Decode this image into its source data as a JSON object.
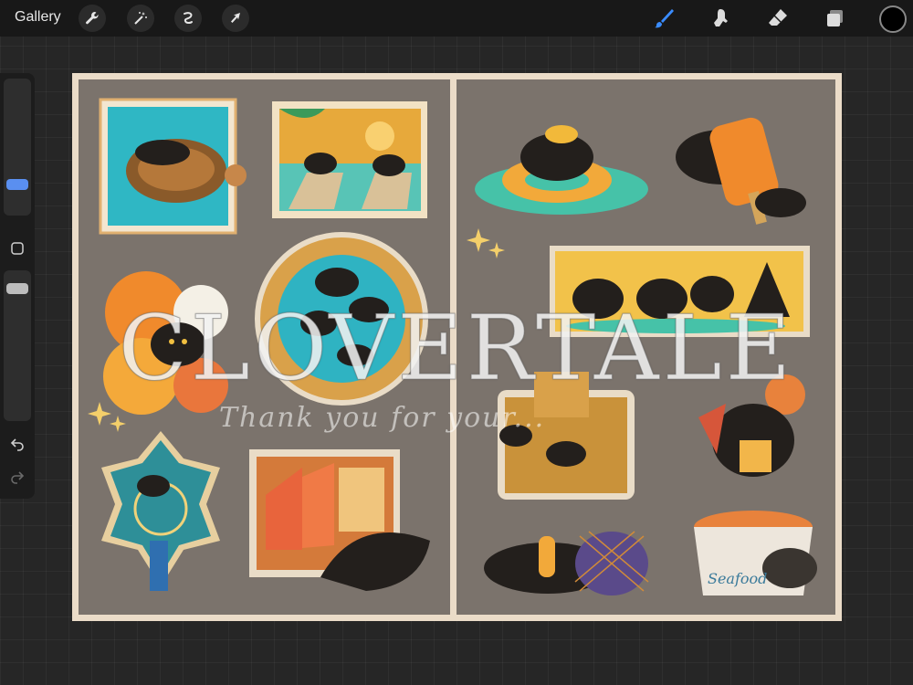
{
  "toolbar": {
    "gallery_label": "Gallery",
    "left_tools": [
      "wrench-icon",
      "magic-wand-icon",
      "selection-icon",
      "transform-arrow-icon"
    ],
    "right_tools": [
      "brush-icon",
      "smudge-icon",
      "eraser-icon",
      "layers-icon"
    ],
    "active_tool": "brush-icon",
    "accent_color": "#3a8cff",
    "current_color": "#000000"
  },
  "sidebar": {
    "brush_size_level": 0.3,
    "opacity_level": 0.75,
    "buttons": [
      "modify-square-icon",
      "undo-icon",
      "redo-icon"
    ]
  },
  "canvas": {
    "border_color": "#ebdcc8",
    "page_color": "#7b736c"
  },
  "watermark": {
    "title": "CLOVERTALE",
    "subtitle": "Thank you for your..."
  },
  "stickers": {
    "left_page": [
      "sea-turtle-sticker",
      "beach-chairs-sticker",
      "hibiscus-sticker",
      "pool-ring-sticker",
      "dreamcatcher-sticker",
      "watermelon-drink-sticker"
    ],
    "right_page": [
      "swim-ring-snorkel-sticker",
      "popsicle-sticker",
      "beach-party-banner-sticker",
      "sandcastle-sticker",
      "chef-crab-sticker",
      "fishing-net-sticker",
      "seafood-pot-sticker"
    ],
    "seafood_label": "Seafood"
  }
}
